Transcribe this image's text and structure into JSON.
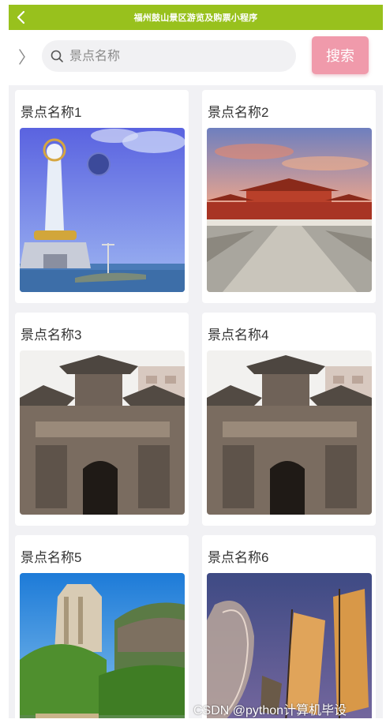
{
  "header": {
    "title": "福州鼓山景区游览及购票小程序",
    "back_icon": "chevron-left-icon"
  },
  "search": {
    "placeholder": "景点名称",
    "button_label": "搜索",
    "side_icon": "chevron-right-icon",
    "search_icon": "search-icon"
  },
  "colors": {
    "navbar": "#98c11d",
    "search_button": "#f09aab",
    "page_bg": "#f1f1f4"
  },
  "spots": [
    {
      "name": "景点名称1",
      "image": "guanyin-statue-image"
    },
    {
      "name": "景点名称2",
      "image": "palace-gate-image"
    },
    {
      "name": "景点名称3",
      "image": "archway-image"
    },
    {
      "name": "景点名称4",
      "image": "archway-image"
    },
    {
      "name": "景点名称5",
      "image": "rock-mountain-image"
    },
    {
      "name": "景点名称6",
      "image": "sailboat-night-image"
    }
  ],
  "watermark": "CSDN @python计算机毕设"
}
